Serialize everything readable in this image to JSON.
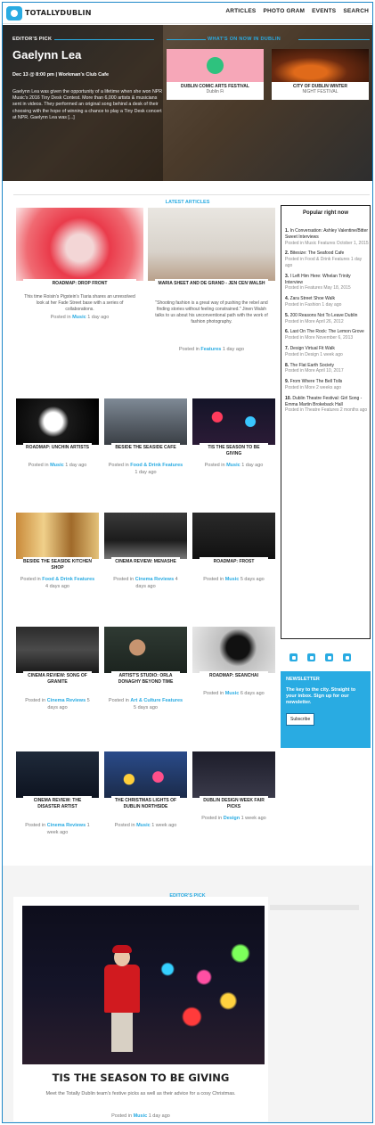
{
  "header": {
    "logo": "TOTALLYDUBLIN",
    "nav": [
      "ARTICLES",
      "PHOTO GRAM",
      "EVENTS",
      "SEARCH"
    ]
  },
  "hero": {
    "pick_label": "EDITOR'S PICK",
    "title": "Gaelynn Lea",
    "date": "Dec 13 @ 8:00 pm | Workman's Club Cafe",
    "text": "Gaelynn Lea was given the opportunity of a lifetime when she won NPR Music's 2016 Tiny Desk Contest. More than 6,000 artists & musicians sent in videos. They performed an original song behind a desk of their choosing with the hope of winning a chance to play a Tiny Desk concert at NPR. Gaelynn Lea was [...]",
    "whats_label": "WHAT'S ON NOW IN DUBLIN",
    "events": [
      {
        "title": "DUBLIN COMIC ARTS FESTIVAL",
        "sub": "Dublin Fi"
      },
      {
        "title": "CITY OF DUBLIN WINTER",
        "sub": "NIGHT FESTIVAL"
      }
    ]
  },
  "latest": {
    "title": "LATEST ARTICLES",
    "big": [
      {
        "caption": "ROADMAP: DROP FRONT",
        "desc": "This time Roisin's Pigstein's Tiaria shares an unresolved look at her Fade Street base with a series of collaborations.",
        "posted": "Posted in",
        "cat": "Music",
        "ago": "1 day ago"
      },
      {
        "caption": "MARIA SHEET AND DE GRAND - JEN CEN WALSH",
        "desc": "\"Shooting fashion is a great way of pushing the rebel and finding stories without feeling constrained.\" Jinen Walsh talks to us about his unconventional path with the work of fashion photography.",
        "posted": "Posted in",
        "cat": "Features",
        "ago": "1 day ago"
      }
    ],
    "grid": [
      {
        "caption": "ROADMAP: UNCHIN ARTISTS",
        "posted": "Posted in",
        "cat": "Music",
        "ago": "1 day ago"
      },
      {
        "caption": "BESIDE THE SEASIDE CAFE",
        "posted": "Posted in",
        "cat": "Food & Drink Features",
        "ago": "1 day ago"
      },
      {
        "caption": "TIS THE SEASON TO BE GIVING",
        "posted": "Posted in",
        "cat": "Music",
        "ago": "1 day ago"
      },
      {
        "caption": "BESIDE THE SEASIDE KITCHEN SHOP",
        "posted": "Posted in",
        "cat": "Food & Drink Features",
        "ago": "4 days ago"
      },
      {
        "caption": "CINEMA REVIEW: MENASHE",
        "posted": "Posted in",
        "cat": "Cinema Reviews",
        "ago": "4 days ago"
      },
      {
        "caption": "ROADMAP: FROST",
        "posted": "Posted in",
        "cat": "Music",
        "ago": "5 days ago"
      },
      {
        "caption": "CINEMA REVIEW: SONG OF GRANITE",
        "posted": "Posted in",
        "cat": "Cinema Reviews",
        "ago": "5 days ago"
      },
      {
        "caption": "ARTIST'S STUDIO: ORLA DONAGHY BEYOND TIME",
        "posted": "Posted in",
        "cat": "Art & Culture Features",
        "ago": "5 days ago"
      },
      {
        "caption": "ROADMAP: SEANCHAI",
        "posted": "Posted in",
        "cat": "Music",
        "ago": "6 days ago"
      },
      {
        "caption": "CINEMA REVIEW: THE DISASTER ARTIST",
        "posted": "Posted in",
        "cat": "Cinema Reviews",
        "ago": "1 week ago"
      },
      {
        "caption": "THE CHRISTMAS LIGHTS OF DUBLIN NORTHSIDE",
        "posted": "Posted in",
        "cat": "Music",
        "ago": "1 week ago"
      },
      {
        "caption": "DUBLIN DESIGN WEEK FAIR PICKS",
        "posted": "Posted in",
        "cat": "Design",
        "ago": "1 week ago"
      }
    ]
  },
  "popular": {
    "title": "Popular right now",
    "items": [
      {
        "n": "1.",
        "t": "In Conversation: Ashley Valentine/Bitter Sweet Interviews",
        "m": "Posted in Music Features October 1, 2015"
      },
      {
        "n": "2.",
        "t": "Bitesize: The Seafood Cafe",
        "m": "Posted in Food & Drink Features 1 day ago"
      },
      {
        "n": "3.",
        "t": "I Left Him Here: Whelan Trinity Interview",
        "m": "Posted in Features May 18, 2015"
      },
      {
        "n": "4.",
        "t": "Zara Street Shoe Walk",
        "m": "Posted in Fashion 1 day ago"
      },
      {
        "n": "5.",
        "t": "200 Reasons Not To Leave Dublin",
        "m": "Posted in More April 26, 2012"
      },
      {
        "n": "6.",
        "t": "Last On The Rock: The Lemon Grove",
        "m": "Posted in More November 6, 2013"
      },
      {
        "n": "7.",
        "t": "Design Virtual Fit Walk",
        "m": "Posted in Design 1 week ago"
      },
      {
        "n": "8.",
        "t": "The Flat Earth Society",
        "m": "Posted in More April 10, 2017"
      },
      {
        "n": "9.",
        "t": "From Where The Bell Tolls",
        "m": "Posted in More 2 weeks ago"
      },
      {
        "n": "10.",
        "t": "Dublin Theatre Festival: Girl Song - Emma Martin Brokeback Hall",
        "m": "Posted in Theatre Features 2 months ago"
      }
    ]
  },
  "newsletter": {
    "title": "NEWSLETTER",
    "text": "The key to the city. Straight to your inbox. Sign up for our newsletter.",
    "button": "Subscribe"
  },
  "editors_pick": {
    "label": "EDITOR'S PICK",
    "title": "TIS THE SEASON TO BE GIVING",
    "desc": "Meet the Totally Dublin team's festive picks as well as their advice for a cosy Christmas.",
    "posted": "Posted in",
    "cat": "Music",
    "ago": "1 day ago"
  }
}
